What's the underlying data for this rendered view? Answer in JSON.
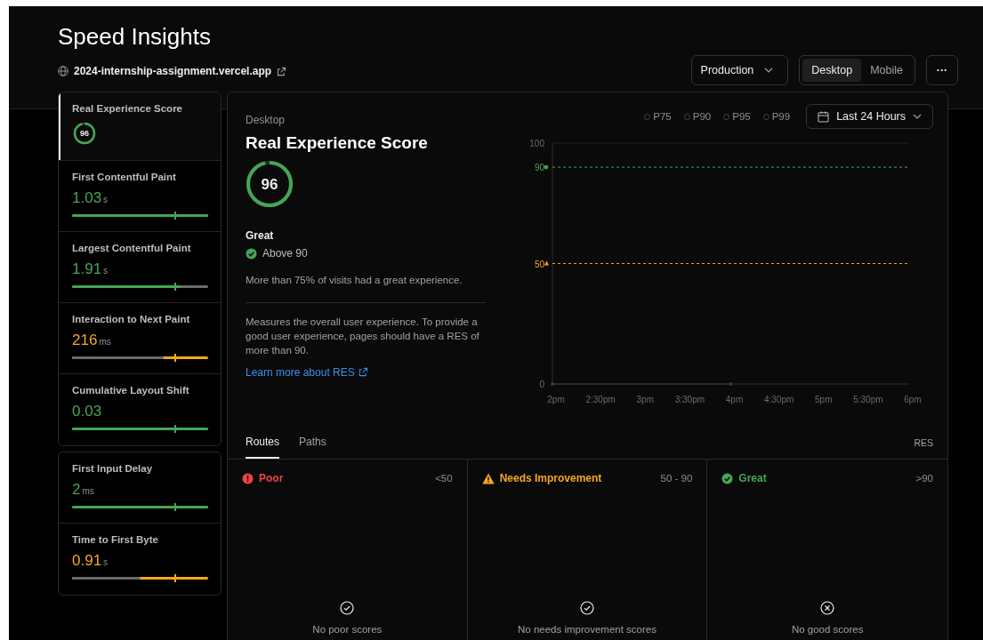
{
  "title": "Speed Insights",
  "site": {
    "url": "2024-internship-assignment.vercel.app"
  },
  "environment": {
    "label": "Production"
  },
  "device_toggle": [
    {
      "label": "Desktop",
      "selected": true
    },
    {
      "label": "Mobile",
      "selected": false
    }
  ],
  "more_button": {
    "label": "···"
  },
  "sidebar": {
    "groups": [
      {
        "items": [
          {
            "kind": "score",
            "label": "Real Experience Score",
            "value": "96",
            "selected": true
          },
          {
            "kind": "metric",
            "label": "First Contentful Paint",
            "value": "1.03",
            "unit": "s",
            "bar": {
              "kind": "good",
              "level": 1
            },
            "selected": false
          },
          {
            "kind": "metric",
            "label": "Largest Contentful Paint",
            "value": "1.91",
            "unit": "s",
            "bar": {
              "kind": "good",
              "level": 0.8
            },
            "selected": false
          },
          {
            "kind": "metric",
            "label": "Interaction to Next Paint",
            "value": "216",
            "unit": "ms",
            "bar": {
              "kind": "needs_improvement",
              "level": 0.67
            },
            "selected": false
          },
          {
            "kind": "metric",
            "label": "Cumulative Layout Shift",
            "value": "0.03",
            "bar": {
              "kind": "good",
              "level": 1
            },
            "selected": false
          }
        ]
      },
      {
        "items": [
          {
            "kind": "metric",
            "label": "First Input Delay",
            "value": "2",
            "unit": "ms",
            "bar": {
              "kind": "good",
              "level": 1
            },
            "selected": false
          },
          {
            "kind": "metric",
            "label": "Time to First Byte",
            "value": "0.91",
            "unit": "s",
            "bar": {
              "kind": "needs_improvement",
              "level": 0.5
            },
            "selected": false
          }
        ]
      }
    ]
  },
  "detail": {
    "device": "Desktop",
    "title": "Real Experience Score",
    "score": "96",
    "rating": "Great",
    "threshold": "Above 90",
    "summary": "More than 75% of visits had a great experience.",
    "description": "Measures the overall user experience. To provide a good user experience, pages should have a RES of more than 90.",
    "link": "Learn more about RES"
  },
  "percentiles": [
    {
      "label": "P75",
      "selected": false
    },
    {
      "label": "P90",
      "selected": false
    },
    {
      "label": "P95",
      "selected": false
    },
    {
      "label": "P99",
      "selected": false
    }
  ],
  "range": {
    "label": "Last 24 Hours"
  },
  "chart_data": {
    "type": "line",
    "categories": [
      "2pm",
      "2:30pm",
      "3pm",
      "3:30pm",
      "4pm",
      "4:30pm",
      "5pm",
      "5:30pm",
      "6pm"
    ],
    "series": [
      {
        "color": "#45a557",
        "line_style": "dashed",
        "values": [
          90,
          90,
          90,
          90,
          90,
          90,
          90,
          90,
          90
        ]
      },
      {
        "color": "#f5a623",
        "line_style": "dashed",
        "values": [
          50,
          50,
          50,
          50,
          50,
          50,
          50,
          50,
          50
        ]
      },
      {
        "color": "#3a3a3a",
        "line_style": "solid",
        "values": [
          0,
          null,
          null,
          null,
          0,
          null,
          null,
          null,
          null
        ]
      }
    ],
    "ylim": [
      0,
      100
    ],
    "yticks": [
      0,
      50,
      90,
      100
    ]
  },
  "tabs": [
    {
      "label": "Routes",
      "selected": true
    },
    {
      "label": "Paths",
      "selected": false
    }
  ],
  "tabs_right_label": "RES",
  "buckets": [
    {
      "kind": "poor",
      "label": "Poor",
      "range": "<50",
      "empty": "No poor scores"
    },
    {
      "kind": "needs_improvement",
      "label": "Needs Improvement",
      "range": "50 - 90",
      "empty": "No needs improvement scores"
    },
    {
      "kind": "great",
      "label": "Great",
      "range": ">90",
      "empty": "No good scores"
    }
  ]
}
